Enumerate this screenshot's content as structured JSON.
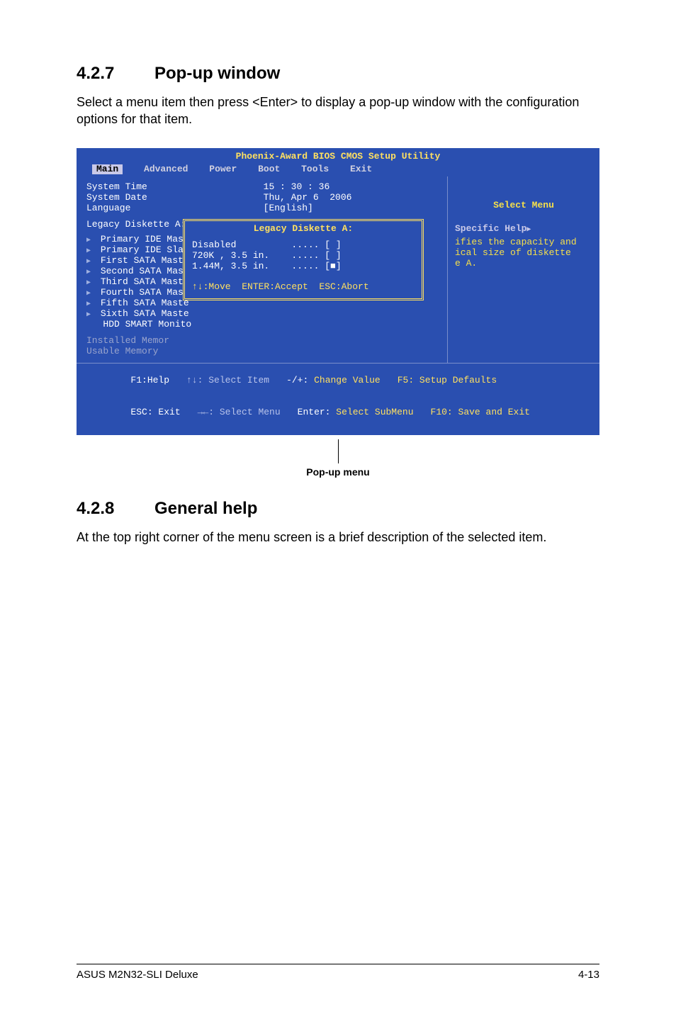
{
  "section1": {
    "num": "4.2.7",
    "title": "Pop-up window",
    "body": "Select a menu item then press <Enter> to display a pop-up window with the configuration options for that item."
  },
  "section2": {
    "num": "4.2.8",
    "title": "General help",
    "body": "At the top right corner of the menu screen is a brief description of the selected item."
  },
  "bios": {
    "utility_title": "Phoenix-Award BIOS CMOS Setup Utility",
    "tabs": [
      "Main",
      "Advanced",
      "Power",
      "Boot",
      "Tools",
      "Exit"
    ],
    "active_tab": "Main",
    "rows_top": [
      "System Time                     15 : 30 : 36",
      "System Date                     Thu, Apr 6  2006",
      "Language                        [English]"
    ],
    "legacy_line": "Legacy Diskette A:",
    "ide_items": [
      "Primary IDE Mast",
      "Primary IDE Slav",
      "First SATA Maste",
      "Second SATA Mast",
      "Third SATA Maste",
      "Fourth SATA Mast",
      "Fifth SATA Maste",
      "Sixth SATA Maste",
      "HDD SMART Monito"
    ],
    "mem_items": [
      "Installed Memor",
      "Usable Memory"
    ],
    "right": {
      "select_menu": "Select Menu",
      "specific_help": "Specific Help",
      "help_lines": "ifies the capacity and\nical size of diskette\ne A."
    },
    "popup": {
      "title": "Legacy Diskette A:",
      "options": [
        "Disabled          ..... [ ]",
        "720K , 3.5 in.    ..... [ ]",
        "1.44M, 3.5 in.    ..... [■]"
      ],
      "hint": "↑↓:Move  ENTER:Accept  ESC:Abort"
    },
    "footer": {
      "l1a": "F1:Help",
      "l1b": "↑↓: Select Item",
      "l1c": "-/+:",
      "l1d": "Change Value",
      "l1e": "F5: Setup Defaults",
      "l2a": "ESC: Exit",
      "l2b": "→←: Select Menu",
      "l2c": "Enter:",
      "l2d": "Select SubMenu",
      "l2e": "F10: Save and Exit"
    }
  },
  "caption": "Pop-up menu",
  "footer_left": "ASUS M2N32-SLI Deluxe",
  "footer_right": "4-13"
}
